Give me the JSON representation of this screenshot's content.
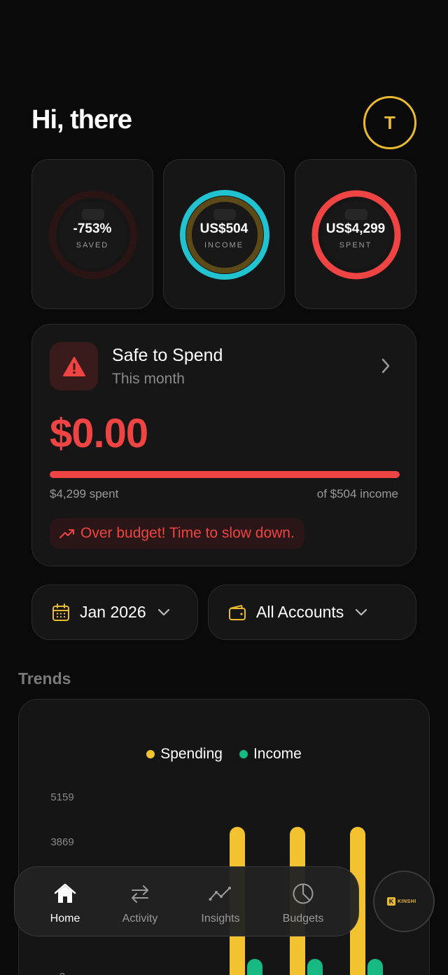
{
  "header": {
    "greeting": "Hi, there",
    "avatar_initial": "T"
  },
  "rings": [
    {
      "value": "-753%",
      "label": "SAVED",
      "ring_color": "#5a1f1f",
      "progress": 0
    },
    {
      "value": "US$504",
      "label": "INCOME",
      "ring_color": "#22c3d0",
      "progress": 1
    },
    {
      "value": "US$4,299",
      "label": "SPENT",
      "ring_color": "#ef4444",
      "progress": 1
    }
  ],
  "safe_to_spend": {
    "title": "Safe to Spend",
    "subtitle": "This month",
    "amount": "$0.00",
    "spent_text": "$4,299 spent",
    "income_text": "of $504 income",
    "progress": 1.0,
    "warning": "Over budget! Time to slow down.",
    "icon": "warning-triangle-icon"
  },
  "filters": {
    "period": "Jan 2026",
    "accounts": "All Accounts"
  },
  "trends": {
    "title": "Trends"
  },
  "chart_data": {
    "type": "bar",
    "series": [
      {
        "name": "Spending",
        "color": "#f2c230",
        "values": [
          4299,
          4299,
          4299
        ]
      },
      {
        "name": "Income",
        "color": "#16b981",
        "values": [
          504,
          504,
          504
        ]
      }
    ],
    "y_ticks": [
      "5159",
      "3869",
      "0"
    ],
    "ylim": [
      0,
      5159
    ],
    "legend": "top-center"
  },
  "colors": {
    "accent": "#e9b92f",
    "danger": "#ef4444",
    "income": "#22c3d0"
  },
  "nav": {
    "items": [
      {
        "label": "Home",
        "icon": "home-icon",
        "active": true
      },
      {
        "label": "Activity",
        "icon": "arrows-swap-icon",
        "active": false
      },
      {
        "label": "Insights",
        "icon": "line-chart-icon",
        "active": false
      },
      {
        "label": "Budgets",
        "icon": "pie-chart-icon",
        "active": false
      }
    ],
    "fab_logo_letter": "K",
    "fab_logo_text": "KINSHI"
  }
}
